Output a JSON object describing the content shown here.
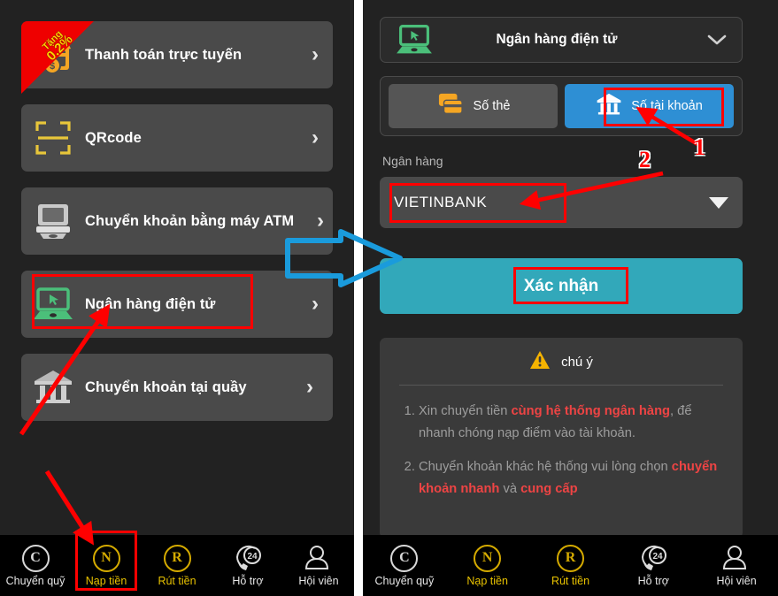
{
  "left_panel": {
    "menu_items": [
      {
        "label": "Thanh toán trực tuyến",
        "icon": "card-money-icon",
        "chevron": "›",
        "badge": {
          "line1": "Tặng",
          "line2": "0.2%"
        }
      },
      {
        "label": "QRcode",
        "icon": "qrcode-icon",
        "chevron": "›"
      },
      {
        "label": "Chuyển khoản bằng máy ATM",
        "icon": "atm-machine-icon",
        "chevron": "›"
      },
      {
        "label": "Ngân hàng điện tử",
        "icon": "laptop-icon",
        "chevron": "›"
      },
      {
        "label": "Chuyển khoản tại quầy",
        "icon": "bank-building-icon",
        "chevron": "›"
      }
    ]
  },
  "nav": {
    "items": [
      {
        "label": "Chuyển quỹ",
        "glyph": "C",
        "icon": "transfer-fund-icon",
        "active": false
      },
      {
        "label": "Nạp tiền",
        "glyph": "N",
        "icon": "deposit-icon",
        "active": true
      },
      {
        "label": "Rút tiền",
        "glyph": "R",
        "icon": "withdraw-icon",
        "active": true
      },
      {
        "label": "Hỗ trợ",
        "glyph": "24",
        "icon": "support-phone-icon",
        "active": false
      },
      {
        "label": "Hội viên",
        "glyph": "",
        "icon": "member-person-icon",
        "active": false
      }
    ]
  },
  "right_panel": {
    "method_select": {
      "value": "Ngân hàng điện tử",
      "icon": "laptop-icon",
      "chevron_icon": "chevron-down-icon"
    },
    "tabs": [
      {
        "label": "Số thẻ",
        "icon": "cards-icon",
        "active": false
      },
      {
        "label": "Số tài khoản",
        "icon": "bank-building-icon",
        "active": true
      }
    ],
    "bank_field": {
      "label": "Ngân hàng",
      "value": "VIETINBANK",
      "caret_icon": "caret-down-icon"
    },
    "confirm_button": "Xác nhận",
    "notice": {
      "title": "chú ý",
      "icon": "warning-triangle-icon",
      "items": [
        {
          "parts": [
            {
              "t": "Xin chuyển tiền ",
              "hl": false
            },
            {
              "t": "cùng hệ thống ngân hàng",
              "hl": true
            },
            {
              "t": ", để nhanh chóng nạp điểm vào tài khoản.",
              "hl": false
            }
          ]
        },
        {
          "parts": [
            {
              "t": "Chuyển khoản khác hệ thống vui lòng chọn ",
              "hl": false
            },
            {
              "t": "chuyển khoản nhanh",
              "hl": true
            },
            {
              "t": " và ",
              "hl": false
            },
            {
              "t": "cung cấp",
              "hl": true
            }
          ]
        }
      ]
    }
  },
  "annotations": {
    "numbers": [
      {
        "text": "1"
      },
      {
        "text": "2"
      }
    ]
  },
  "colors": {
    "panel_bg": "#222222",
    "card_bg": "#4a4a4a",
    "accent_blue": "#2e8fd4",
    "accent_teal": "#32a8ba",
    "annotation_red": "#ff0000",
    "arrow_blue": "#1a9bdc",
    "gold": "#e8c200",
    "highlight_red": "#ee4444"
  }
}
